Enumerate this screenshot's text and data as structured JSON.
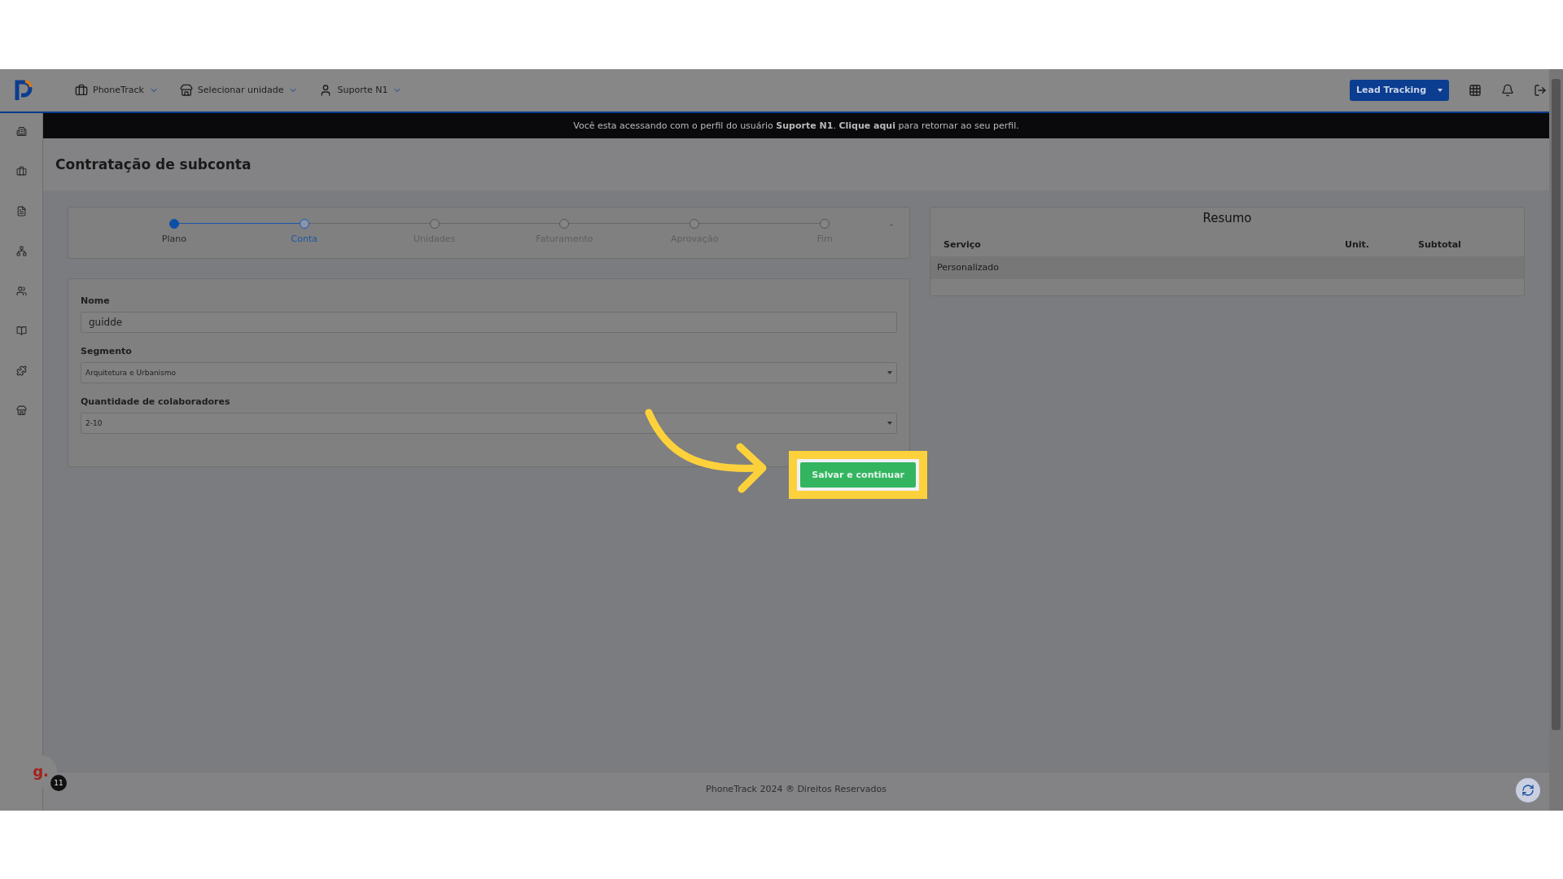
{
  "header": {
    "menus": [
      {
        "label": "PhoneTrack"
      },
      {
        "label": "Selecionar unidade"
      },
      {
        "label": "Suporte N1"
      }
    ],
    "product_button": {
      "label": "Lead Tracking"
    }
  },
  "banner": {
    "text": "Você esta acessando com o perfil do usuário **Suporte N1**. **Clique aqui** para retornar ao seu perfil."
  },
  "page": {
    "title": "Contratação de subconta"
  },
  "stepper": {
    "steps": [
      {
        "label": "Plano",
        "completed": true,
        "selected": false
      },
      {
        "label": "Conta",
        "completed": false,
        "selected": true
      },
      {
        "label": "Unidades",
        "completed": false,
        "selected": false
      },
      {
        "label": "Faturamento",
        "completed": false,
        "selected": false
      },
      {
        "label": "Aprovação",
        "completed": false,
        "selected": false
      },
      {
        "label": "Fim",
        "completed": false,
        "selected": false
      }
    ],
    "trailing": "-"
  },
  "form": {
    "fields": [
      {
        "label": "Nome",
        "kind": "text",
        "value": "guidde"
      },
      {
        "label": "Segmento",
        "kind": "select",
        "value": "Arquitetura e Urbanismo"
      },
      {
        "label": "Quantidade de colaboradores",
        "kind": "select",
        "value": "2-10"
      }
    ],
    "submit": "Salvar e continuar"
  },
  "summary": {
    "title": "Resumo",
    "columns": [
      "Serviço",
      "Unit.",
      "Subtotal"
    ],
    "rows": [
      [
        "Personalizado",
        "",
        ""
      ]
    ]
  },
  "footer": {
    "text": "PhoneTrack 2024 ® Direitos Reservados"
  },
  "assistant": {
    "letter": "g.",
    "badge": "11"
  }
}
